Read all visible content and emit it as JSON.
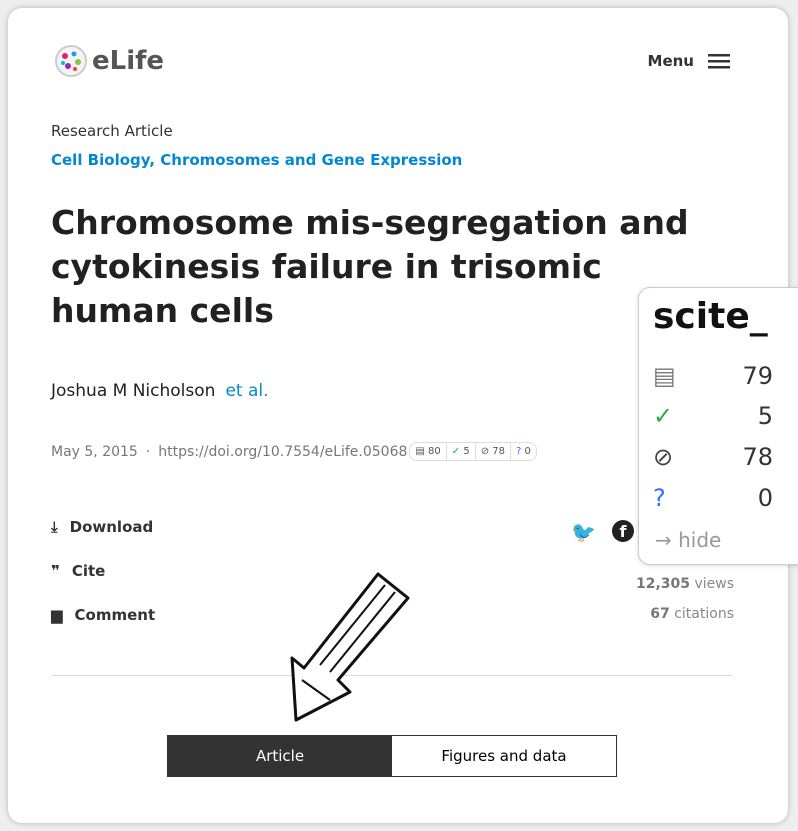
{
  "header": {
    "logo": "eLife",
    "menu_label": "Menu"
  },
  "article": {
    "type": "Research Article",
    "subjects": "Cell Biology, Chromosomes and Gene Expression",
    "title": "Chromosome mis-segregation and cytokinesis failure in trisomic human cells",
    "author": "Joshua M Nicholson",
    "et_al": "et al.",
    "date": "May 5, 2015",
    "separator": "·",
    "doi": "https://doi.org/10.7554/eLife.05068",
    "badge": {
      "publications": "80",
      "supporting": "5",
      "mentioning": "78",
      "contrasting": "0"
    }
  },
  "actions": {
    "download": "Download",
    "cite": "Cite",
    "comment": "Comment"
  },
  "stats": {
    "views_count": "12,305",
    "views_label": "views",
    "citations_count": "67",
    "citations_label": "citations"
  },
  "tabs": {
    "article": "Article",
    "figures": "Figures and data"
  },
  "scite": {
    "brand": "scite_",
    "publications": "79",
    "supporting": "5",
    "mentioning": "78",
    "contrasting": "0",
    "hide": "→ hide"
  },
  "colors": {
    "link": "#0288d1",
    "supporting": "#2eaa4a",
    "contrasting": "#2f6ff5"
  }
}
